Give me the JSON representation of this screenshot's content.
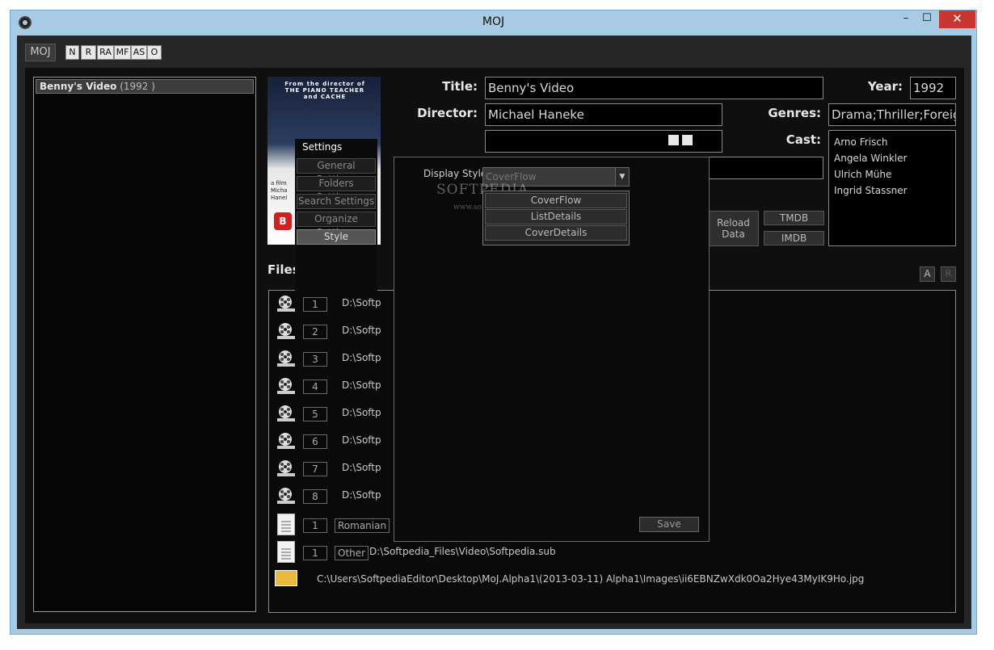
{
  "window": {
    "title": "MOJ",
    "minimize": "–",
    "maximize": "☐",
    "close": "✕"
  },
  "toolbar": {
    "moj_label": "MOJ",
    "filters": [
      "N",
      "R",
      "RA",
      "MF",
      "AS",
      "O"
    ]
  },
  "movie_list": {
    "items": [
      {
        "title": "Benny's Video",
        "year": "(1992 )"
      }
    ]
  },
  "poster": {
    "tagline": "From the director of THE PIANO TEACHER and CACHE",
    "credit": "a film Micha Hanel",
    "logo": "B"
  },
  "details": {
    "title_label": "Title:",
    "title_value": "Benny's Video",
    "director_label": "Director:",
    "director_value": "Michael Haneke",
    "year_label": "Year:",
    "year_value": "1992",
    "genres_label": "Genres:",
    "genres_value": "Drama;Thriller;Foreig",
    "cast_label": "Cast:",
    "cast": [
      "Arno Frisch",
      "Angela Winkler",
      "Ulrich Mühe",
      "Ingrid Stassner"
    ]
  },
  "buttons": {
    "reload": "Reload Data",
    "tmdb": "TMDB",
    "imdb": "IMDB",
    "a": "A",
    "r": "R"
  },
  "files": {
    "title": "Files",
    "rows": [
      {
        "num": "1",
        "path": "D:\\Softp"
      },
      {
        "num": "2",
        "path": "D:\\Softp"
      },
      {
        "num": "3",
        "path": "D:\\Softp"
      },
      {
        "num": "4",
        "path": "D:\\Softp"
      },
      {
        "num": "5",
        "path": "D:\\Softp"
      },
      {
        "num": "6",
        "path": "D:\\Softp"
      },
      {
        "num": "7",
        "path": "D:\\Softp"
      },
      {
        "num": "8",
        "path": "D:\\Softp"
      }
    ],
    "subtitle_romanian": {
      "num": "1",
      "type": "Romanian"
    },
    "subtitle_other": {
      "num": "1",
      "type": "Other",
      "path": "D:\\Softpedia_Files\\Video\\Softpedia.sub"
    },
    "image_path": "C:\\Users\\SoftpediaEditor\\Desktop\\MoJ.Alpha1\\(2013-03-11) Alpha1\\Images\\ii6EBNZwXdk0Oa2Hye43MyIK9Ho.jpg"
  },
  "settings": {
    "title": "Settings",
    "tabs": [
      "General Settings",
      "Folders Settings",
      "Search Settings",
      "Organize Settings",
      "Style"
    ],
    "active_tab": "Style",
    "display_style_label": "Display Style",
    "display_style_value": "CoverFlow",
    "display_style_options": [
      "CoverFlow",
      "ListDetails",
      "CoverDetails"
    ],
    "save_label": "Save",
    "watermark": "SOFTPEDIA",
    "watermark_url": "www.softpedia.com"
  }
}
